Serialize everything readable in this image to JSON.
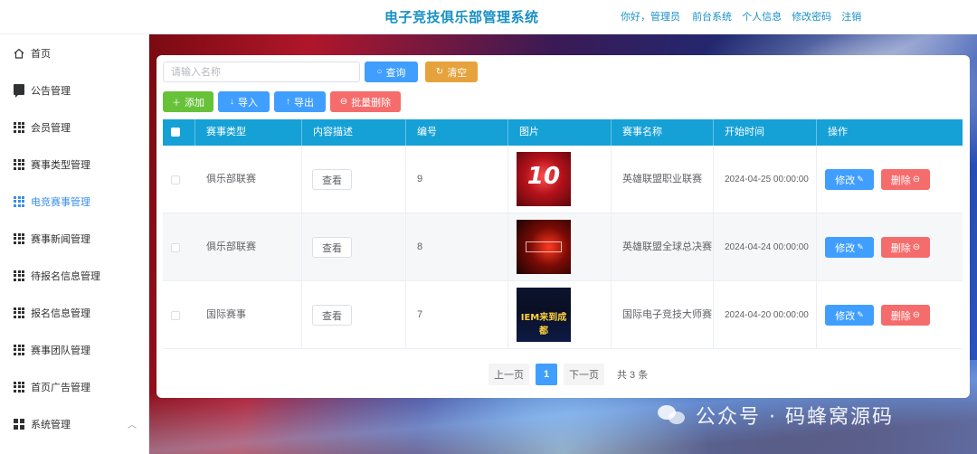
{
  "header": {
    "title": "电子竞技俱乐部管理系统",
    "greeting": "你好，管理员",
    "links": [
      "前台系统",
      "个人信息",
      "修改密码",
      "注销"
    ]
  },
  "sidebar": {
    "items": [
      {
        "label": "首页",
        "icon": "home-icon"
      },
      {
        "label": "公告管理",
        "icon": "chat-icon"
      },
      {
        "label": "会员管理",
        "icon": "grid-icon"
      },
      {
        "label": "赛事类型管理",
        "icon": "grid-icon"
      },
      {
        "label": "电竞赛事管理",
        "icon": "grid-icon",
        "active": true
      },
      {
        "label": "赛事新闻管理",
        "icon": "grid-icon"
      },
      {
        "label": "待报名信息管理",
        "icon": "grid-icon"
      },
      {
        "label": "报名信息管理",
        "icon": "grid-icon"
      },
      {
        "label": "赛事团队管理",
        "icon": "grid-icon"
      },
      {
        "label": "首页广告管理",
        "icon": "grid-icon"
      },
      {
        "label": "系统管理",
        "icon": "grid4-icon"
      }
    ]
  },
  "toolbar": {
    "search_placeholder": "请输入名称",
    "query_label": "查询",
    "clear_label": "清空",
    "add_label": "添加",
    "import_label": "导入",
    "export_label": "导出",
    "batch_delete_label": "批量删除"
  },
  "table": {
    "columns": [
      "赛事类型",
      "内容描述",
      "编号",
      "图片",
      "赛事名称",
      "开始时间",
      "操作"
    ],
    "rows": [
      {
        "type": "俱乐部联赛",
        "desc_btn": "查看",
        "id": "9",
        "image_text": "10",
        "name": "英雄联盟职业联赛",
        "start": "2024-04-25 00:00:00",
        "edit": "修改",
        "delete": "删除"
      },
      {
        "type": "俱乐部联赛",
        "desc_btn": "查看",
        "id": "8",
        "image_text": "",
        "name": "英雄联盟全球总决赛",
        "start": "2024-04-24 00:00:00",
        "edit": "修改",
        "delete": "删除"
      },
      {
        "type": "国际赛事",
        "desc_btn": "查看",
        "id": "7",
        "image_text": "IEM来到成都",
        "name": "国际电子竞技大师赛",
        "start": "2024-04-20 00:00:00",
        "edit": "修改",
        "delete": "删除"
      }
    ]
  },
  "pagination": {
    "prev": "上一页",
    "current": "1",
    "next": "下一页",
    "total": "共 3 条"
  },
  "watermark": "公众号 · 码蜂窝源码",
  "colors": {
    "primary": "#409eff",
    "success": "#67c23a",
    "warning": "#e6a23c",
    "danger": "#f56c6c",
    "table_header": "#15a0d6",
    "title": "#1890c6"
  }
}
